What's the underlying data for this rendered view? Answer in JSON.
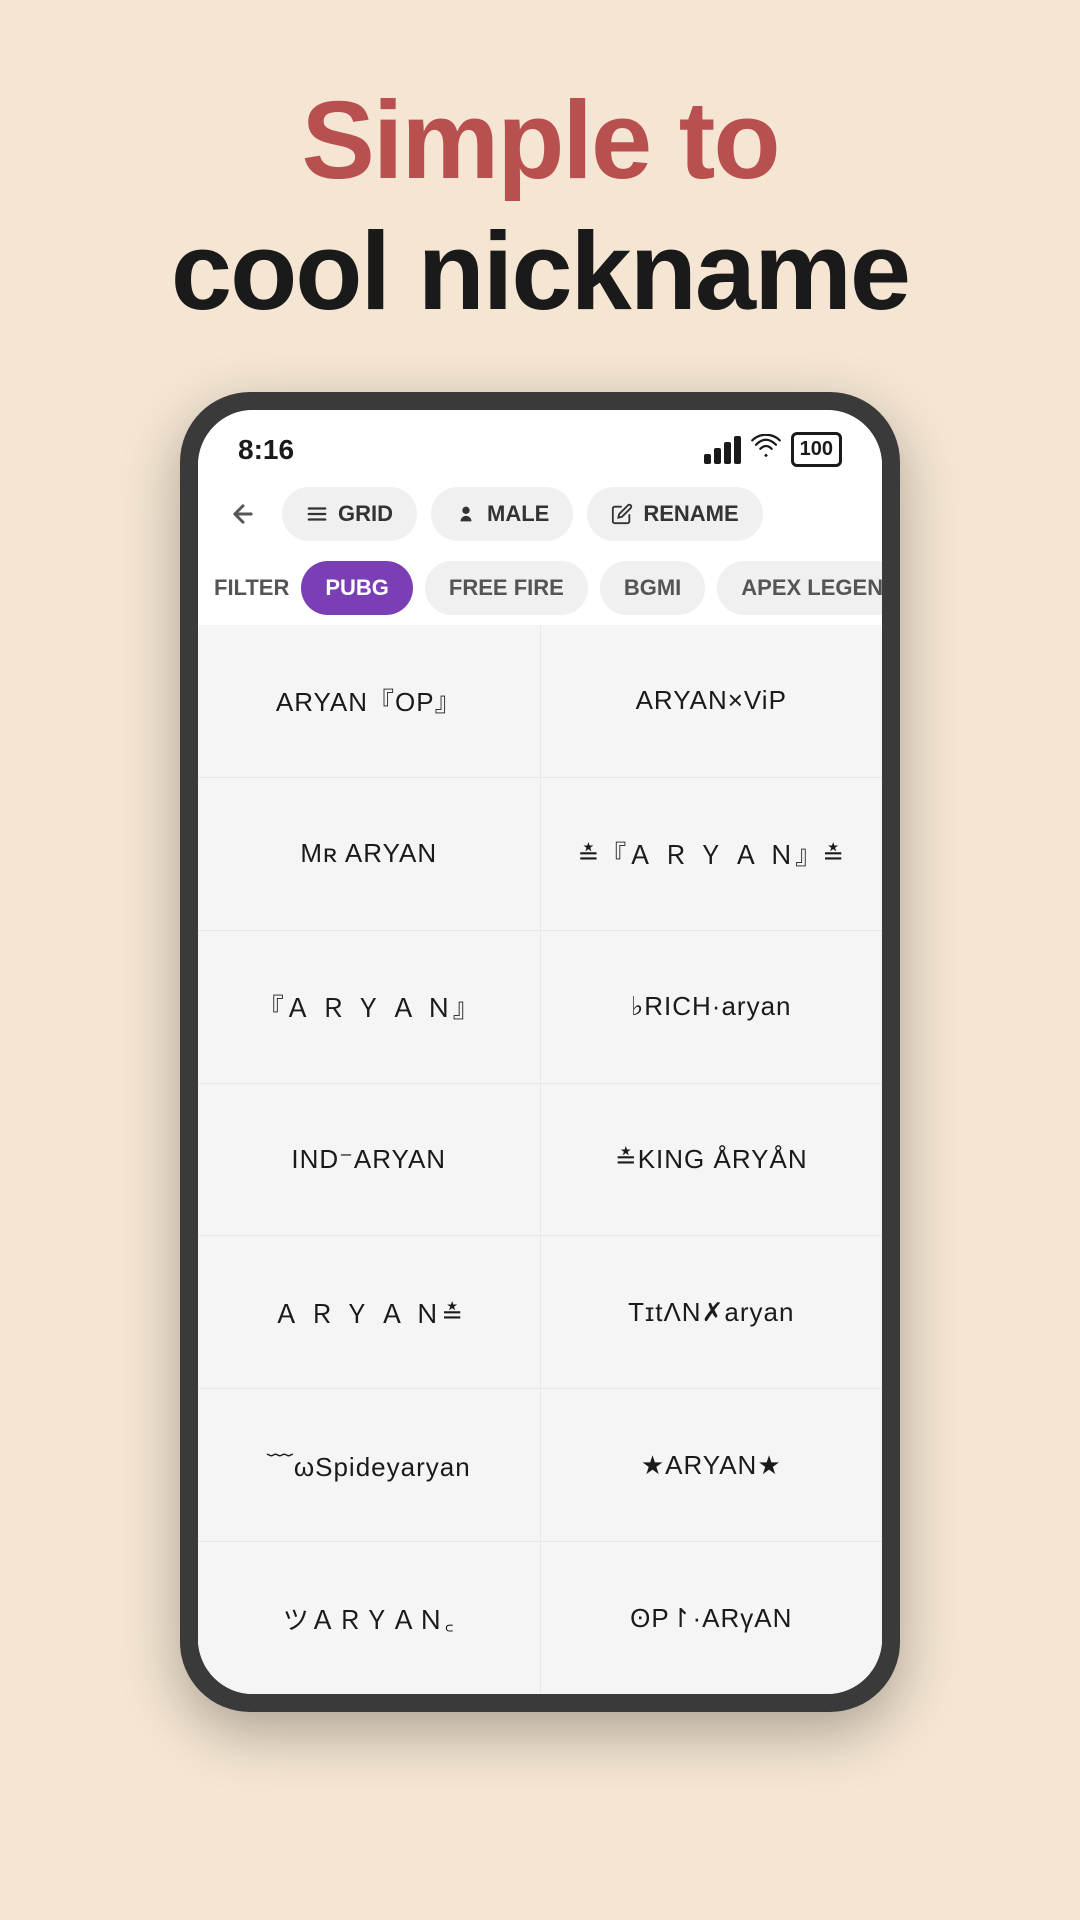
{
  "page": {
    "background_color": "#f5e6d3",
    "header": {
      "line1": "Simple to",
      "line2": "cool nickname"
    }
  },
  "status_bar": {
    "time": "8:16",
    "battery": "100"
  },
  "nav_bar": {
    "back_label": "←",
    "chips": [
      {
        "label": "GRID",
        "icon": "list"
      },
      {
        "label": "MALE",
        "icon": "person"
      },
      {
        "label": "RENAME",
        "icon": "edit"
      }
    ]
  },
  "filter_bar": {
    "label": "FILTER",
    "chips": [
      {
        "label": "PUBG",
        "active": true
      },
      {
        "label": "FREE FIRE",
        "active": false
      },
      {
        "label": "BGMI",
        "active": false
      },
      {
        "label": "APEX LEGEND",
        "active": false
      }
    ]
  },
  "nicknames": [
    {
      "text": "ARYAN『OP』"
    },
    {
      "text": "ARYAN×ViP"
    },
    {
      "text": "Mʀ ARYAN"
    },
    {
      "text": "≛『Ａ Ｒ Ｙ Ａ Ｎ』≛"
    },
    {
      "text": "『Ａ Ｒ Ｙ Ａ Ｎ』"
    },
    {
      "text": "♭RICH·aryan"
    },
    {
      "text": "IND⁻ARYAN"
    },
    {
      "text": "≛KING ÅRYÅN"
    },
    {
      "text": "Ａ Ｒ Ｙ Ａ Ｎ≛"
    },
    {
      "text": "TɪtΛN✗aryan"
    },
    {
      "text": "﹋ωSpideyaryan"
    },
    {
      "text": "★ARYAN★"
    },
    {
      "text": "ツＡＲＹＡＮ꜀"
    },
    {
      "text": "ʘΡ↾·ARγAN"
    }
  ]
}
